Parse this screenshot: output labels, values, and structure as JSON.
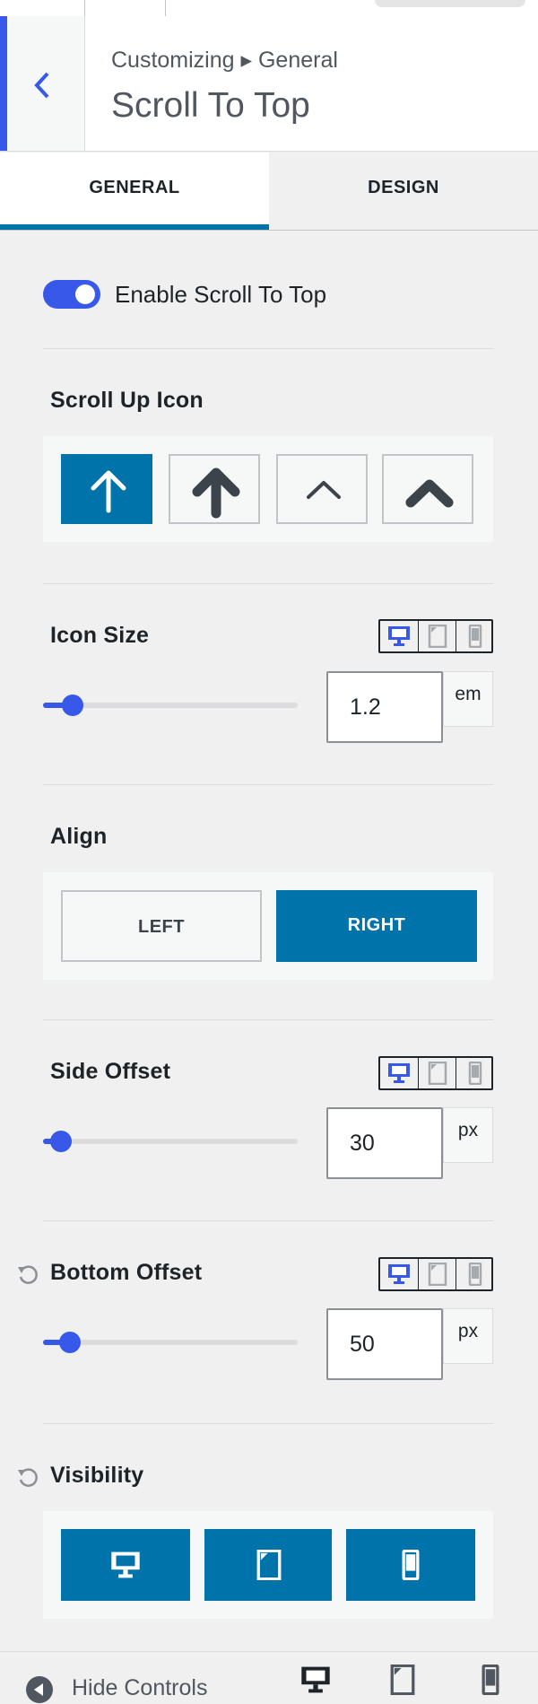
{
  "header": {
    "breadcrumb": "Customizing ▸ General",
    "title": "Scroll To Top",
    "back_icon": "chevron-left-icon"
  },
  "tabs": [
    {
      "label": "GENERAL",
      "active": true
    },
    {
      "label": "DESIGN",
      "active": false
    }
  ],
  "enable_toggle": {
    "label": "Enable Scroll To Top",
    "on": true
  },
  "scroll_up_icon": {
    "title": "Scroll Up Icon",
    "options": [
      "arrow-up-thin-icon",
      "arrow-up-bold-icon",
      "chevron-up-thin-icon",
      "chevron-up-bold-icon"
    ],
    "selected_index": 0
  },
  "icon_size": {
    "title": "Icon Size",
    "value": "1.2",
    "unit": "em",
    "slider_fraction": 0.1
  },
  "align": {
    "title": "Align",
    "options": [
      "LEFT",
      "RIGHT"
    ],
    "selected": "RIGHT"
  },
  "side_offset": {
    "title": "Side Offset",
    "value": "30",
    "unit": "px",
    "slider_fraction": 0.05
  },
  "bottom_offset": {
    "title": "Bottom Offset",
    "value": "50",
    "unit": "px",
    "slider_fraction": 0.09
  },
  "visibility": {
    "title": "Visibility",
    "options": [
      "desktop-icon",
      "tablet-icon",
      "mobile-icon"
    ]
  },
  "footer": {
    "hide_label": "Hide Controls"
  },
  "colors": {
    "accent": "#3858e9",
    "button": "#0073aa",
    "panel": "#f0f0f1"
  }
}
